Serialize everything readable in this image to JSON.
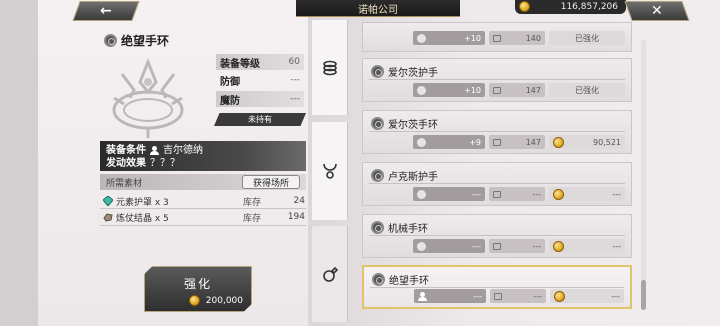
{
  "topbar": {
    "back_icon": "arrow-left-icon",
    "title": "诺帕公司",
    "gold_amount": "116,857,206",
    "close_icon": "close-x-icon"
  },
  "item": {
    "name": "绝望手环",
    "stats": [
      {
        "label": "装备等级",
        "value": "60"
      },
      {
        "label": "防御",
        "value": "---"
      },
      {
        "label": "魔防",
        "value": "---"
      }
    ],
    "owned_status": "未持有",
    "condition_label": "装备条件",
    "condition_value": "吉尔德纳",
    "effect_label": "发动效果",
    "effect_value": "？？？"
  },
  "materials": {
    "header": "所需素材",
    "obtain_button": "获得场所",
    "stock_label": "库存",
    "rows": [
      {
        "name": "元素护罩 x 3",
        "stock": "24",
        "icon": "crystal-icon"
      },
      {
        "name": "炼仗结晶 x 5",
        "stock": "194",
        "icon": "ore-icon"
      }
    ]
  },
  "enhance": {
    "label": "强化",
    "cost": "200,000"
  },
  "tabs": [
    {
      "icon": "spiral-icon",
      "selected": false
    },
    {
      "icon": "necklace-icon",
      "selected": false
    },
    {
      "icon": "ring-icon",
      "selected": true
    }
  ],
  "list": [
    {
      "name": "",
      "level": "+10",
      "slots": "140",
      "price": "已强化",
      "price_coin": false
    },
    {
      "name": "爱尔茨护手",
      "level": "+10",
      "slots": "147",
      "price": "已强化",
      "price_coin": false
    },
    {
      "name": "爱尔茨手环",
      "level": "+9",
      "slots": "147",
      "price": "90,521",
      "price_coin": true
    },
    {
      "name": "卢克斯护手",
      "level": "---",
      "slots": "---",
      "price": "---",
      "price_coin": true
    },
    {
      "name": "机械手环",
      "level": "---",
      "slots": "---",
      "price": "---",
      "price_coin": true
    },
    {
      "name": "绝望手环",
      "level": "---",
      "slots": "---",
      "price": "---",
      "price_coin": true
    }
  ],
  "colors": {
    "accent_gold": "#e0c46a",
    "dark_panel": "#2a2a2a"
  }
}
